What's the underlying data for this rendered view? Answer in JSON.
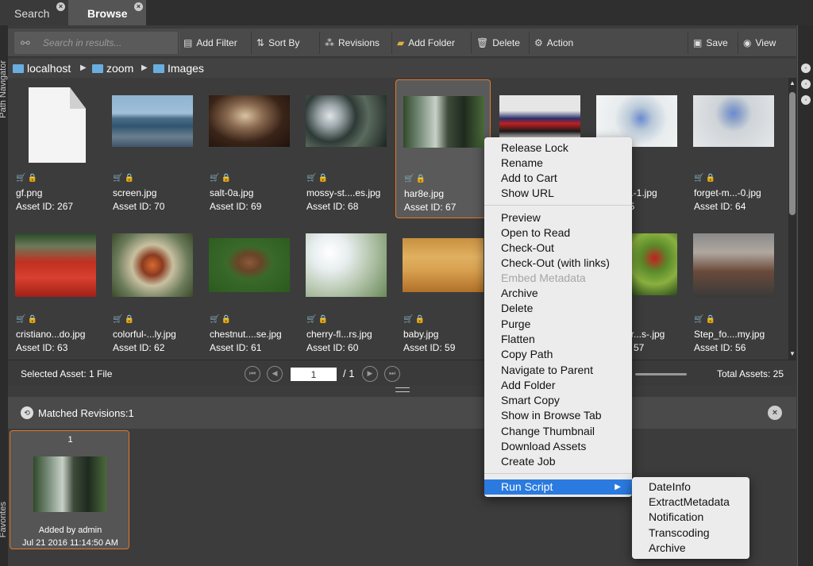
{
  "tabs": [
    {
      "label": "Search"
    },
    {
      "label": "Browse"
    }
  ],
  "side_labels": {
    "left_top": "Path Navigator",
    "left_bottom": "Favorites"
  },
  "toolbar": {
    "search_placeholder": "Search in results...",
    "add_filter": "Add Filter",
    "sort_by": "Sort By",
    "revisions": "Revisions",
    "add_folder": "Add Folder",
    "delete": "Delete",
    "action": "Action",
    "save": "Save",
    "view": "View"
  },
  "breadcrumb": [
    "localhost",
    "zoom",
    "Images"
  ],
  "assets": [
    {
      "name": "gf.png",
      "id": "Asset ID: 267"
    },
    {
      "name": "screen.jpg",
      "id": "Asset ID: 70"
    },
    {
      "name": "salt-0a.jpg",
      "id": "Asset ID: 69"
    },
    {
      "name": "mossy-st....es.jpg",
      "id": "Asset ID: 68"
    },
    {
      "name": "har8e.jpg",
      "id": "Asset ID: 67"
    },
    {
      "name": "",
      "id": ""
    },
    {
      "name": "n...-1.jpg",
      "id": "65"
    },
    {
      "name": "forget-m...-0.jpg",
      "id": "Asset ID: 64"
    },
    {
      "name": "cristiano...do.jpg",
      "id": "Asset ID: 63"
    },
    {
      "name": "colorful-...ly.jpg",
      "id": "Asset ID: 62"
    },
    {
      "name": "chestnut....se.jpg",
      "id": "Asset ID: 61"
    },
    {
      "name": "cherry-fl...rs.jpg",
      "id": "Asset ID: 60"
    },
    {
      "name": "baby.jpg",
      "id": "Asset ID: 59"
    },
    {
      "name": "",
      "id": ""
    },
    {
      "name": "er...s-.jpg",
      "id": "57"
    },
    {
      "name": "Step_fo....my.jpg",
      "id": "Asset ID: 56"
    }
  ],
  "status": {
    "selected": "Selected Asset: 1 File",
    "page": "1",
    "of": "/ 1",
    "total": "Total Assets: 25"
  },
  "revisions_panel": {
    "title": "Matched Revisions:1",
    "card_number": "1",
    "added_by": "Added by admin",
    "date": "Jul 21 2016 11:14:50 AM"
  },
  "context_menu": {
    "group1": [
      "Release Lock",
      "Rename",
      "Add to Cart",
      "Show URL"
    ],
    "group2": [
      "Preview",
      "Open to Read",
      "Check-Out",
      "Check-Out (with links)",
      "Embed Metadata",
      "Archive",
      "Delete",
      "Purge",
      "Flatten",
      "Copy Path",
      "Navigate to Parent",
      "Add Folder",
      "Smart Copy",
      "Show in Browse Tab",
      "Change Thumbnail",
      "Download Assets",
      "Create Job"
    ],
    "run_script": "Run Script",
    "disabled_item": "Embed Metadata"
  },
  "submenu": [
    "DateInfo",
    "ExtractMetadata",
    "Notification",
    "Transcoding",
    "Archive"
  ],
  "colors": {
    "accent": "#2a7adf",
    "selection_border": "#e07a2a",
    "cart": "#e88a2a"
  }
}
